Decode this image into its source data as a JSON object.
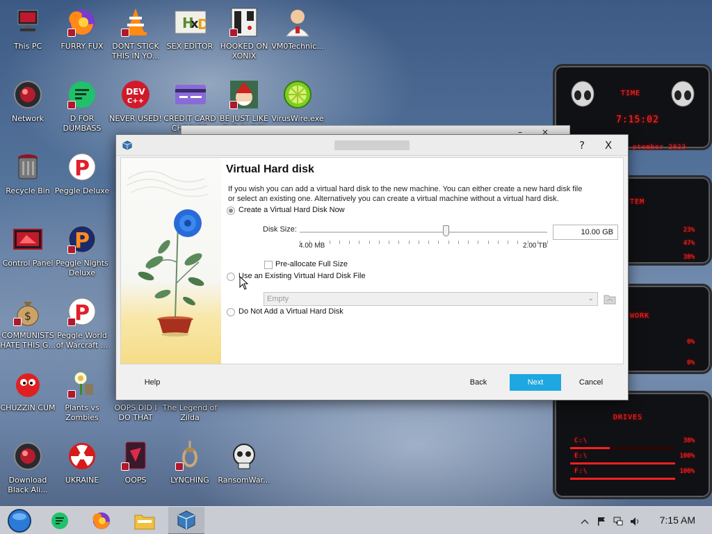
{
  "desktop": {
    "icons": [
      {
        "label": "This PC",
        "icon": "computer-icon"
      },
      {
        "label": "FURRY FUX",
        "icon": "firefox-icon"
      },
      {
        "label": "DONT STICK THIS IN YO...",
        "icon": "vlc-cone-icon"
      },
      {
        "label": "SEX EDITOR",
        "icon": "hex-editor-icon"
      },
      {
        "label": "HOOKED ON XONIX",
        "icon": "xonix-game-icon"
      },
      {
        "label": "VM0Technic...",
        "icon": "doctor-icon"
      },
      {
        "label": "Network",
        "icon": "network-orb-icon"
      },
      {
        "label": "D FOR DUMBASS",
        "icon": "green-chat-icon"
      },
      {
        "label": "NEVER USED!",
        "icon": "dev-cpp-icon"
      },
      {
        "label": "CREDIT CARD CHECKER",
        "icon": "credit-card-icon"
      },
      {
        "label": "BE JUST LIKE THE DUDE!",
        "icon": "santa-icon"
      },
      {
        "label": "VirusWire.exe",
        "icon": "lime-icon"
      },
      {
        "label": "Recycle Bin",
        "icon": "recycle-bin-icon"
      },
      {
        "label": "Peggle Deluxe",
        "icon": "peggle-icon"
      },
      {
        "label": "Control Panel",
        "icon": "control-panel-icon"
      },
      {
        "label": "Peggle Nights Deluxe",
        "icon": "peggle-nights-icon"
      },
      {
        "label": "COMMUNISTS HATE THIS G...",
        "icon": "money-bag-icon"
      },
      {
        "label": "Peggle World of Warcraft ...",
        "icon": "peggle-wow-icon"
      },
      {
        "label": "CHUZZIN CUM",
        "icon": "chuzzle-icon"
      },
      {
        "label": "Plants vs Zombies",
        "icon": "plants-vs-zombies-icon"
      },
      {
        "label": "OOPS DID I DO THAT",
        "icon": "oops-icon"
      },
      {
        "label": "The Legend of Zilda",
        "icon": "zelda-icon"
      },
      {
        "label": "Download Black Ali...",
        "icon": "black-alien-icon"
      },
      {
        "label": "UKRAINE",
        "icon": "radiation-icon"
      },
      {
        "label": "OOPS",
        "icon": "oops2-icon"
      },
      {
        "label": "LYNCHING",
        "icon": "noose-icon"
      },
      {
        "label": "RansomWar...",
        "icon": "skull-icon"
      }
    ]
  },
  "widget": {
    "time_title": "TIME",
    "time": "7:15:02",
    "date": "ptember 2023",
    "system_title": "TEM",
    "system_values": [
      "23%",
      "47%",
      "38%"
    ],
    "network_title": "WORK",
    "network_values": [
      "0%",
      "0%"
    ],
    "drives_title": "DRIVES",
    "drives": [
      {
        "name": "C:\\",
        "value": "38%"
      },
      {
        "name": "E:\\",
        "value": "100%"
      },
      {
        "name": "F:\\",
        "value": "100%"
      }
    ]
  },
  "dialog": {
    "title_help": "?",
    "title_close": "X",
    "heading": "Virtual Hard disk",
    "description": "If you wish you can add a virtual hard disk to the new machine. You can either create a new hard disk file or select an existing one. Alternatively you can create a virtual machine without a virtual hard disk.",
    "options": {
      "create_now": "Create a Virtual Hard Disk Now",
      "use_existing": "Use an Existing Virtual Hard Disk File",
      "do_not_add": "Do Not Add a Virtual Hard Disk"
    },
    "selected_option": "create_now",
    "disk_size_label": "Disk Size:",
    "disk_size_value": "10.00 GB",
    "slider_min": "4.00 MB",
    "slider_max": "2.00 TB",
    "slider_position": 0.59,
    "preallocate_label": "Pre-allocate Full Size",
    "preallocate_checked": false,
    "existing_file_value": "Empty",
    "buttons": {
      "help": "Help",
      "back": "Back",
      "next": "Next",
      "cancel": "Cancel"
    }
  },
  "taskbar": {
    "clock": "7:15 AM",
    "items": [
      "start-orb-icon",
      "green-chat-icon",
      "firefox-icon",
      "file-explorer-icon",
      "virtualbox-icon"
    ],
    "tray": [
      "chevron-up-icon",
      "flag-icon",
      "network-icon",
      "speaker-icon"
    ]
  },
  "colors": {
    "accent": "#1ea7e0",
    "widget_red": "#ff2a2a"
  }
}
